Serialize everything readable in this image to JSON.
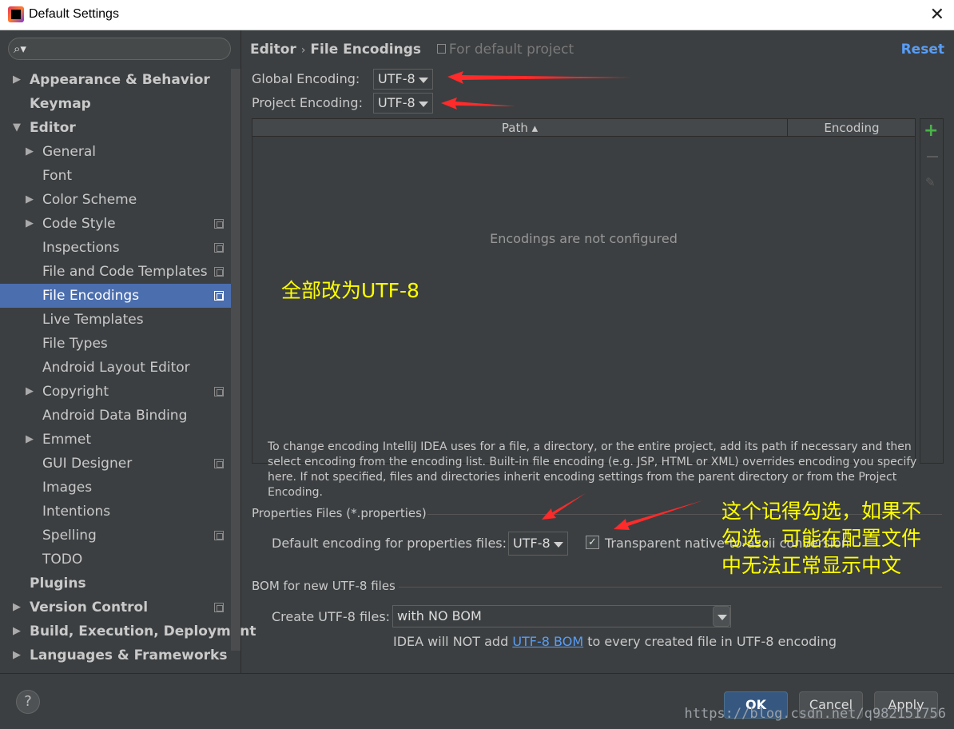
{
  "window": {
    "title": "Default Settings",
    "close_label": "✕"
  },
  "sidebar": {
    "search_icon": "search-icon",
    "items": [
      {
        "label": "Appearance & Behavior",
        "bold": true,
        "arrow": "▶",
        "indent": 0,
        "copy": false
      },
      {
        "label": "Keymap",
        "bold": true,
        "arrow": "",
        "indent": 0,
        "copy": false
      },
      {
        "label": "Editor",
        "bold": true,
        "arrow": "▼",
        "indent": 0,
        "copy": false
      },
      {
        "label": "General",
        "bold": false,
        "arrow": "▶",
        "indent": 1,
        "copy": false
      },
      {
        "label": "Font",
        "bold": false,
        "arrow": "",
        "indent": 1,
        "copy": false
      },
      {
        "label": "Color Scheme",
        "bold": false,
        "arrow": "▶",
        "indent": 1,
        "copy": false
      },
      {
        "label": "Code Style",
        "bold": false,
        "arrow": "▶",
        "indent": 1,
        "copy": true
      },
      {
        "label": "Inspections",
        "bold": false,
        "arrow": "",
        "indent": 1,
        "copy": true
      },
      {
        "label": "File and Code Templates",
        "bold": false,
        "arrow": "",
        "indent": 1,
        "copy": true
      },
      {
        "label": "File Encodings",
        "bold": false,
        "arrow": "",
        "indent": 1,
        "copy": true,
        "selected": true
      },
      {
        "label": "Live Templates",
        "bold": false,
        "arrow": "",
        "indent": 1,
        "copy": false
      },
      {
        "label": "File Types",
        "bold": false,
        "arrow": "",
        "indent": 1,
        "copy": false
      },
      {
        "label": "Android Layout Editor",
        "bold": false,
        "arrow": "",
        "indent": 1,
        "copy": false
      },
      {
        "label": "Copyright",
        "bold": false,
        "arrow": "▶",
        "indent": 1,
        "copy": true
      },
      {
        "label": "Android Data Binding",
        "bold": false,
        "arrow": "",
        "indent": 1,
        "copy": false
      },
      {
        "label": "Emmet",
        "bold": false,
        "arrow": "▶",
        "indent": 1,
        "copy": false
      },
      {
        "label": "GUI Designer",
        "bold": false,
        "arrow": "",
        "indent": 1,
        "copy": true
      },
      {
        "label": "Images",
        "bold": false,
        "arrow": "",
        "indent": 1,
        "copy": false
      },
      {
        "label": "Intentions",
        "bold": false,
        "arrow": "",
        "indent": 1,
        "copy": false
      },
      {
        "label": "Spelling",
        "bold": false,
        "arrow": "",
        "indent": 1,
        "copy": true
      },
      {
        "label": "TODO",
        "bold": false,
        "arrow": "",
        "indent": 1,
        "copy": false
      },
      {
        "label": "Plugins",
        "bold": true,
        "arrow": "",
        "indent": 0,
        "copy": false
      },
      {
        "label": "Version Control",
        "bold": true,
        "arrow": "▶",
        "indent": 0,
        "copy": true
      },
      {
        "label": "Build, Execution, Deployment",
        "bold": true,
        "arrow": "▶",
        "indent": 0,
        "copy": false
      },
      {
        "label": "Languages & Frameworks",
        "bold": true,
        "arrow": "▶",
        "indent": 0,
        "copy": false
      }
    ]
  },
  "header": {
    "crumb_1": "Editor",
    "crumb_sep": "›",
    "crumb_2": "File Encodings",
    "scope": "For default project",
    "reset": "Reset"
  },
  "encodings": {
    "global_label": "Global Encoding:",
    "global_value": "UTF-8",
    "project_label": "Project Encoding:",
    "project_value": "UTF-8"
  },
  "table": {
    "col_path": "Path ▴",
    "col_encoding": "Encoding",
    "empty_text": "Encodings are not configured",
    "add_label": "+",
    "edit_label": "✎"
  },
  "help_text": "To change encoding IntelliJ IDEA uses for a file, a directory, or the entire project, add its path if necessary and then select encoding from the encoding list. Built-in file encoding (e.g. JSP, HTML or XML) overrides encoding you specify here. If not specified, files and directories inherit encoding settings from the parent directory or from the Project Encoding.",
  "properties": {
    "section_title": "Properties Files (*.properties)",
    "default_label": "Default encoding for properties files:",
    "default_value": "UTF-8",
    "checkbox_checked": true,
    "checkbox_mark": "✓",
    "checkbox_label": "Transparent native-to-ascii conversion"
  },
  "bom": {
    "section_title": "BOM for new UTF-8 files",
    "create_label": "Create UTF-8 files:",
    "create_value": "with NO BOM",
    "note_prefix": "IDEA will NOT add ",
    "note_link": "UTF-8 BOM",
    "note_suffix": " to every created file in UTF-8 encoding"
  },
  "annotations": {
    "note_1": "全部改为UTF-8",
    "note_2_line1": "这个记得勾选，如果不",
    "note_2_line2": "勾选，可能在配置文件",
    "note_2_line3": "中无法正常显示中文",
    "color": "#ffff00",
    "arrow_color": "#ff2a2a"
  },
  "footer": {
    "help": "?",
    "ok": "OK",
    "cancel": "Cancel",
    "apply": "Apply",
    "watermark": "https://blog.csdn.net/q982151756"
  }
}
